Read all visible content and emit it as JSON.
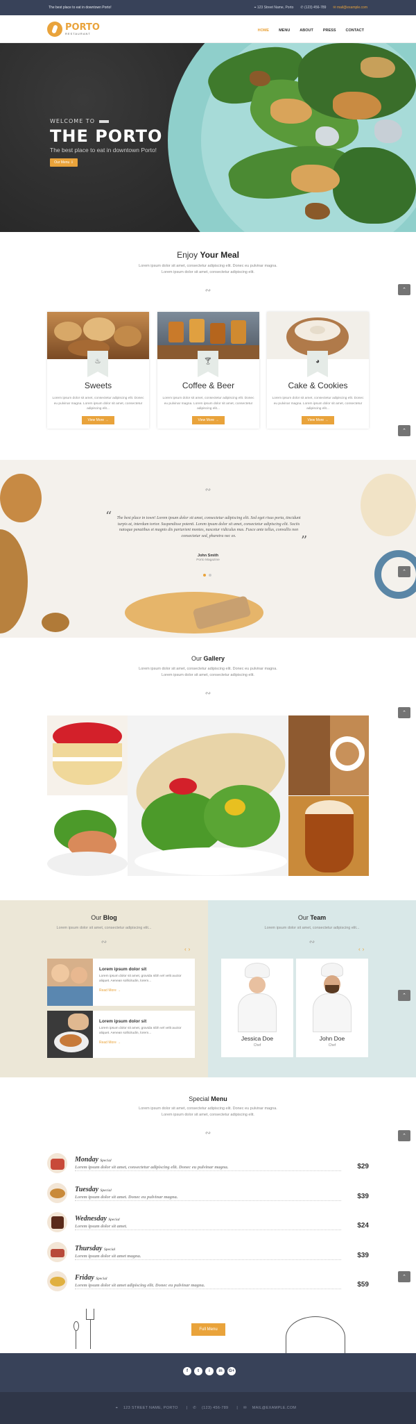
{
  "topbar": {
    "tagline": "The best place to eat in downtown Porto!",
    "address": "123 Street Name, Porto",
    "phone": "(123) 456-789",
    "email": "mail@example.com"
  },
  "logo": {
    "name": "PORTO",
    "sub": "RESTAURANT"
  },
  "nav": [
    "HOME",
    "MENU",
    "ABOUT",
    "PRESS",
    "CONTACT"
  ],
  "hero": {
    "welcome": "WELCOME TO",
    "title": "THE PORTO",
    "subtitle": "The best place to eat in downtown Porto!",
    "button": "Our Menu"
  },
  "meal": {
    "title_pre": "Enjoy",
    "title_bold": "Your Meal",
    "text1": "Lorem ipsum dolor sit amet, consectetur adipiscing elit. Donec eu pulvinar magna.",
    "text2": "Lorem ipsum dolor sit amet, consectetur adipiscing elit.",
    "cards": [
      {
        "title": "Sweets",
        "text": "Lorem ipsum dolor sit amet, consectetur adipiscing elit. Donec eu pulvinar magna. Lorem ipsum dolor sit amet, consectetur adipiscing elit...",
        "button": "View More",
        "icon": "cupcake-icon"
      },
      {
        "title": "Coffee & Beer",
        "text": "Lorem ipsum dolor sit amet, consectetur adipiscing elit. Donec eu pulvinar magna. Lorem ipsum dolor sit amet, consectetur adipiscing elit...",
        "button": "View More",
        "icon": "glass-icon"
      },
      {
        "title": "Cake & Cookies",
        "text": "Lorem ipsum dolor sit amet, consectetur adipiscing elit. Donec eu pulvinar magna. Lorem ipsum dolor sit amet, consectetur adipiscing elit...",
        "button": "View More",
        "icon": "cake-icon"
      }
    ]
  },
  "testimonial": {
    "quote": "The best place in town! Lorem ipsum dolor sit amet, consectetur adipiscing elit. Sed eget risus porta, tincidunt turpis at, interdum tortor. Suspendisse potenti. Lorem ipsum dolor sit amet, consectetur adipiscing elit. Sociis natoque penatibus et magnis dis parturient montes, nascetur ridiculus mus. Fusce ante tellus, convallis non consectetur sed, pharetra nec ex.",
    "author": "John Smith",
    "company": "Porto Magazine"
  },
  "gallery": {
    "title_pre": "Our",
    "title_bold": "Gallery",
    "text1": "Lorem ipsum dolor sit amet, consectetur adipiscing elit. Donec eu pulvinar magna.",
    "text2": "Lorem ipsum dolor sit amet, consectetur adipiscing elit."
  },
  "blog": {
    "title_pre": "Our",
    "title_bold": "Blog",
    "text": "Lorem ipsum dolor sit amet, consectetur adipiscing elit...",
    "posts": [
      {
        "title": "Lorem ipsum dolor sit",
        "text": "Lorem ipsum dolor sit amet, gravida nibh vel velit auctor aliquet. Aenean sollicitudin, lorem...",
        "more": "Read More"
      },
      {
        "title": "Lorem ipsum dolor sit",
        "text": "Lorem ipsum dolor sit amet, gravida nibh vel velit auctor aliquet. Aenean sollicitudin, lorem...",
        "more": "Read More"
      }
    ]
  },
  "team": {
    "title_pre": "Our",
    "title_bold": "Team",
    "text": "Lorem ipsum dolor sit amet, consectetur adipiscing elit...",
    "members": [
      {
        "name": "Jessica Doe",
        "role": "Chef"
      },
      {
        "name": "John Doe",
        "role": "Chef"
      }
    ]
  },
  "special": {
    "title_pre": "Special",
    "title_bold": "Menu",
    "text1": "Lorem ipsum dolor sit amet, consectetur adipiscing elit. Donec eu pulvinar magna.",
    "text2": "Lorem ipsum dolor sit amet, consectetur adipiscing elit.",
    "items": [
      {
        "day": "Monday",
        "tag": "Special",
        "desc": "Lorem ipsum dolor sit amet, consectetur adipiscing elit. Donec eu pulvinar magna.",
        "price": "$29"
      },
      {
        "day": "Tuesday",
        "tag": "Special",
        "desc": "Lorem ipsum dolor sit amet. Donec eu pulvinar magna.",
        "price": "$39"
      },
      {
        "day": "Wednesday",
        "tag": "Special",
        "desc": "Lorem ipsum dolor sit amet.",
        "price": "$24"
      },
      {
        "day": "Thursday",
        "tag": "Special",
        "desc": "Lorem ipsum dolor sit amet magna.",
        "price": "$39"
      },
      {
        "day": "Friday",
        "tag": "Special",
        "desc": "Lorem ipsum dolor sit amet adipiscing elit. Donec eu pulvinar magna.",
        "price": "$59"
      }
    ],
    "button": "Full Menu"
  },
  "footer": {
    "social": [
      "f",
      "t",
      "i",
      "in",
      "G+"
    ],
    "address": "123 STREET NAME, PORTO",
    "phone": "(123) 456-789",
    "email": "MAIL@EXAMPLE.COM"
  },
  "colors": {
    "accent": "#e9a33b",
    "dark": "#384259",
    "blog_bg": "#ece7d7",
    "team_bg": "#d9e8e8"
  }
}
